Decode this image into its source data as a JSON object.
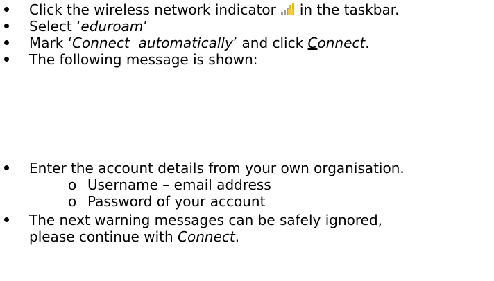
{
  "steps": [
    {
      "before_icon": "Click the wireless network indicator",
      "icon": "wifi-signal-icon",
      "after_icon": "in the taskbar."
    },
    {
      "prefix": "Select ‘",
      "emphasis": "eduroam",
      "suffix": "’"
    },
    {
      "prefix": "Mark ‘",
      "emphasis": "Connect  automatically",
      "middle": "’ and click ",
      "link_first_letter": "C",
      "link_rest": "onnect",
      "suffix": "."
    },
    {
      "text": "The following message is shown:"
    },
    {
      "text": "Enter the account details from your own organisation.",
      "sub_items": [
        {
          "marker": "o",
          "text": "Username – email address"
        },
        {
          "marker": "o",
          "text": "Password of your account"
        }
      ]
    },
    {
      "line1": "The next warning messages can be safely ignored,",
      "line2_prefix": "please continue with ",
      "line2_emphasis": "Connect",
      "line2_suffix": "."
    }
  ],
  "colors": {
    "text": "#000000",
    "background": "#ffffff",
    "icon_bars": "#9a9a9a",
    "icon_highlight": "#f5b800"
  }
}
